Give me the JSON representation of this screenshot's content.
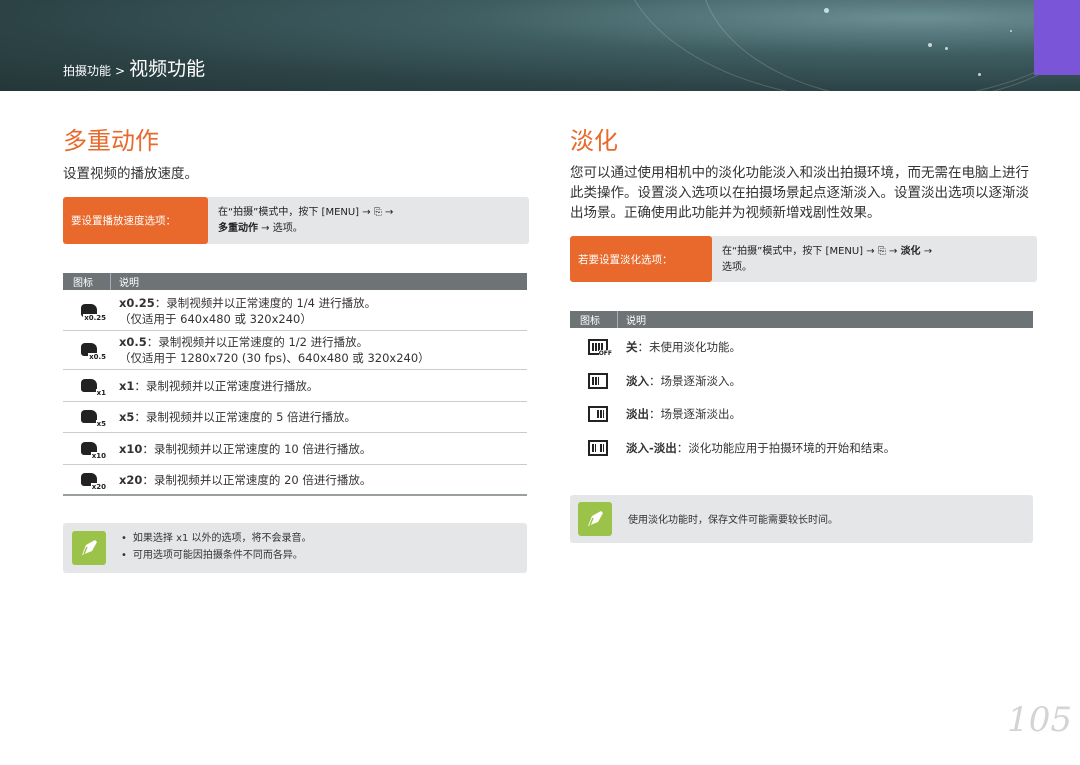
{
  "header": {
    "crumb_small": "拍摄功能",
    "crumb_sep": ">",
    "crumb_big": "视频功能"
  },
  "left": {
    "title": "多重动作",
    "lead": "设置视频的播放速度。",
    "instr_label": "要设置播放速度选项：",
    "instr_line1": "在“拍摄”模式中，按下 [MENU] → ⎘ →",
    "instr_line2_bold": "多重动作",
    "instr_line2_rest": " → 选项。",
    "table_headers": [
      "图标",
      "说明"
    ],
    "rows": [
      {
        "icon": "x0.25",
        "bold": "x0.25",
        "text": "：录制视频并以正常速度的 1/4 进行播放。",
        "sub": "（仅适用于 640x480 或 320x240）"
      },
      {
        "icon": "x0.5",
        "bold": "x0.5",
        "text": "：录制视频并以正常速度的 1/2 进行播放。",
        "sub": "（仅适用于 1280x720 (30 fps)、640x480 或 320x240）"
      },
      {
        "icon": "x1",
        "bold": "x1",
        "text": "：录制视频并以正常速度进行播放。",
        "sub": ""
      },
      {
        "icon": "x5",
        "bold": "x5",
        "text": "：录制视频并以正常速度的 5 倍进行播放。",
        "sub": ""
      },
      {
        "icon": "x10",
        "bold": "x10",
        "text": "：录制视频并以正常速度的 10 倍进行播放。",
        "sub": ""
      },
      {
        "icon": "x20",
        "bold": "x20",
        "text": "：录制视频并以正常速度的 20 倍进行播放。",
        "sub": ""
      }
    ],
    "notes": [
      "如果选择 x1 以外的选项，将不会录音。",
      "可用选项可能因拍摄条件不同而各异。"
    ]
  },
  "right": {
    "title": "淡化",
    "lead": "您可以通过使用相机中的淡化功能淡入和淡出拍摄环境，而无需在电脑上进行此类操作。设置淡入选项以在拍摄场景起点逐渐淡入。设置淡出选项以逐渐淡出场景。正确使用此功能并为视频新增戏剧性效果。",
    "instr_label": "若要设置淡化选项：",
    "instr_line1_a": "在“拍摄”模式中，按下 [MENU] → ⎘ → ",
    "instr_line1_bold": "淡化",
    "instr_line1_b": " →",
    "instr_line2": "选项。",
    "table_headers": [
      "图标",
      "说明"
    ],
    "rows": [
      {
        "icon": "fade-off",
        "bold": "关",
        "text": "：未使用淡化功能。"
      },
      {
        "icon": "fade-in",
        "bold": "淡入",
        "text": "：场景逐渐淡入。"
      },
      {
        "icon": "fade-out",
        "bold": "淡出",
        "text": "：场景逐渐淡出。"
      },
      {
        "icon": "fade-in-out",
        "bold": "淡入-淡出",
        "text": "：淡化功能应用于拍摄环境的开始和结束。"
      }
    ],
    "note": "使用淡化功能时，保存文件可能需要较长时间。"
  },
  "page_number": "105",
  "colors": {
    "accent": "#e9692c",
    "header_bg": "#2c4346",
    "tab": "#7b55d8",
    "note_icon": "#9bc34a"
  }
}
